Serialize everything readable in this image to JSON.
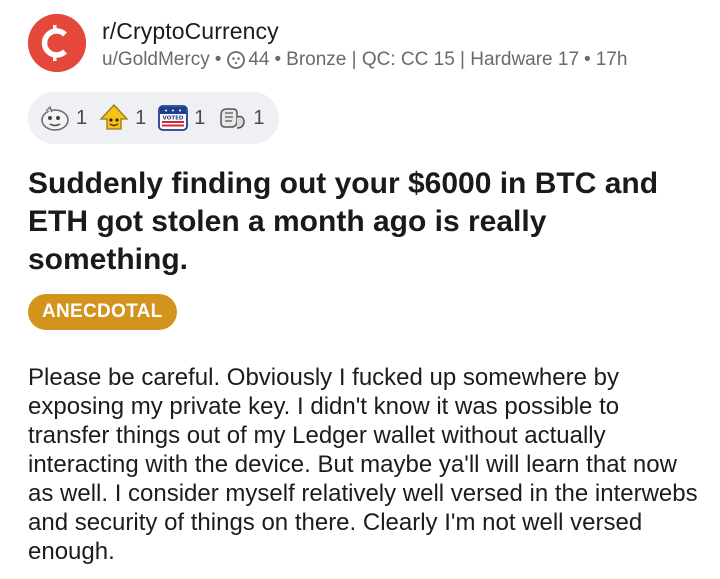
{
  "colors": {
    "subreddit_avatar": "#e4483a",
    "flair_background": "#d3941d",
    "award_bar_background": "#eef0f4",
    "meta_text": "#6a6a6a"
  },
  "header": {
    "subreddit": "r/CryptoCurrency",
    "avatar_icon": "cryptocurrency-logo-icon",
    "username": "u/GoldMercy",
    "karma_icon": "moon-token-icon",
    "karma": "44",
    "user_flair": "Bronze | QC: CC 15 | Hardware 17",
    "time_ago": "17h",
    "separator": "•"
  },
  "awards": [
    {
      "icon": "helpful-award-icon",
      "count": "1"
    },
    {
      "icon": "wholesome-award-icon",
      "count": "1"
    },
    {
      "icon": "i-voted-award-icon",
      "count": "1"
    },
    {
      "icon": "fist-bump-award-icon",
      "count": "1"
    }
  ],
  "post": {
    "title": "Suddenly finding out your $6000 in BTC and ETH got stolen a month ago is really something.",
    "flair": "ANECDOTAL",
    "body": "Please be careful. Obviously I fucked up somewhere by exposing my private key. I didn't know it was possible to transfer things out of my Ledger wallet without actually interacting with the device. But maybe ya'll will learn that now as well. I consider myself relatively well versed in the interwebs and security of things on there. Clearly I'm not well versed enough."
  }
}
